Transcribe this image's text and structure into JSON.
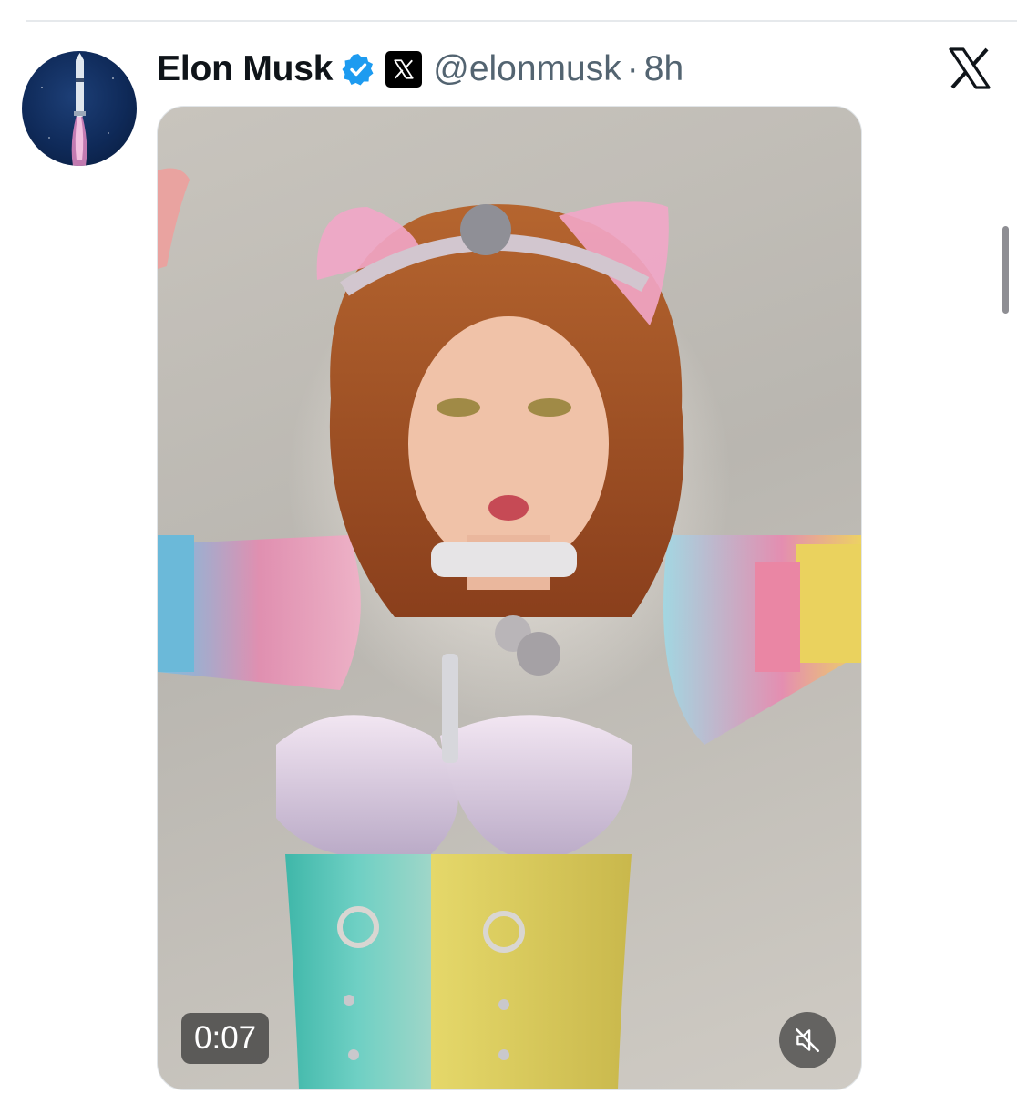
{
  "tweet": {
    "author_name": "Elon Musk",
    "handle": "@elonmusk",
    "separator": "·",
    "time": "8h",
    "verified": true,
    "affiliate_badge_icon": "x-logo-icon",
    "media": {
      "type": "video",
      "duration": "0:07",
      "muted": true
    }
  },
  "icons": {
    "avatar": "rocket-avatar",
    "verified": "verified-badge-icon",
    "brand": "x-logo-icon",
    "mute": "mute-icon"
  },
  "colors": {
    "name": "#0f1419",
    "secondary_text": "#536471",
    "verified_blue": "#1d9bf0"
  }
}
